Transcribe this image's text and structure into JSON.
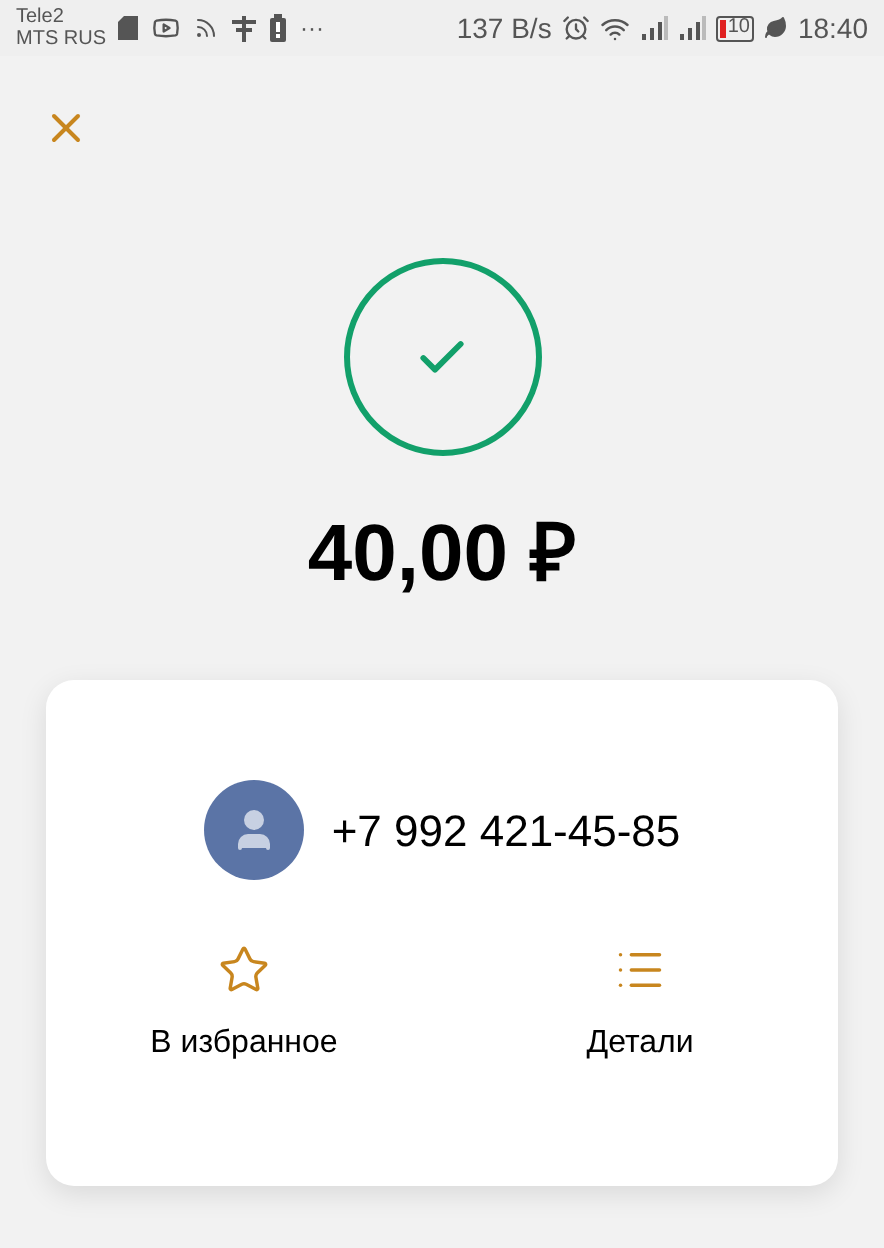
{
  "status_bar": {
    "carriers": [
      "Tele2",
      "MTS RUS"
    ],
    "more": "···",
    "speed": "137 B/s",
    "battery": "10",
    "time": "18:40"
  },
  "amount": "40,00 ₽",
  "contact": {
    "phone": "+7 992 421-45-85"
  },
  "actions": [
    {
      "kind": "favorite",
      "label": "В избранное"
    },
    {
      "kind": "details",
      "label": "Детали"
    }
  ]
}
